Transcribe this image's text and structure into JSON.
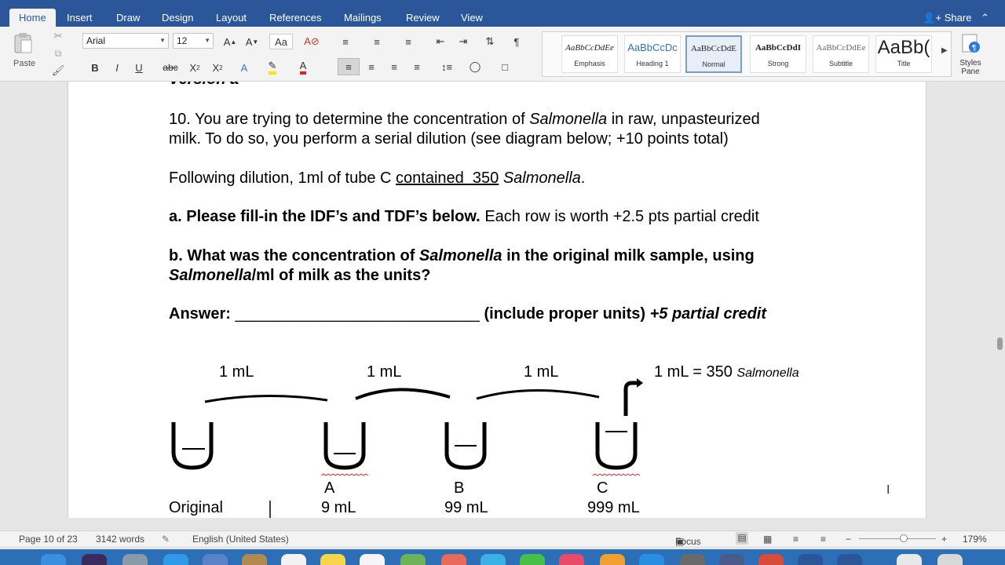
{
  "tabs": [
    "Home",
    "Insert",
    "Draw",
    "Design",
    "Layout",
    "References",
    "Mailings",
    "Review",
    "View"
  ],
  "share_label": "Share",
  "ribbon": {
    "paste_label": "Paste",
    "font_name": "Arial",
    "font_size": "12",
    "styles": [
      {
        "preview": "AaBbCcDdEe",
        "name": "Emphasis"
      },
      {
        "preview": "AaBbCcDc",
        "name": "Heading 1"
      },
      {
        "preview": "AaBbCcDdE",
        "name": "Normal"
      },
      {
        "preview": "AaBbCcDdI",
        "name": "Strong"
      },
      {
        "preview": "AaBbCcDdEe",
        "name": "Subtitle"
      },
      {
        "preview": "AaBb(",
        "name": "Title"
      }
    ],
    "styles_pane_label": "Styles Pane"
  },
  "doc": {
    "version_label": "Version a",
    "q10_num": "10.",
    "q10_a": "You are trying to determine the concentration of",
    "q10_organism": "Salmonella",
    "q10_b": "in raw, unpasteurized",
    "q10_line2": "milk. To do so, you perform a serial dilution (see diagram below; +10 points total)",
    "following_a": "Following dilution, 1ml of tube C",
    "following_ul": "contained  350",
    "following_org": "Salmonella",
    "following_end": ".",
    "a_bold": "a. Please fill-in the IDF’s and TDF’s below.",
    "a_rest": "Each row is worth +2.5 pts partial credit",
    "b_1": "b. What was the concentration of",
    "b_org": "Salmonella",
    "b_2": "in the original milk sample, using",
    "b_org2": "Salmonella",
    "b_3": "/ml of milk as the units?",
    "answer_label": "Answer:",
    "answer_blank": "____________________________",
    "answer_units": "(include proper units)",
    "answer_credit": "+5 partial credit",
    "transfers": [
      "1 mL",
      "1 mL",
      "1 mL"
    ],
    "final_a": "1 mL = 350",
    "final_org": "Salmonella",
    "tube_labels": [
      "A",
      "B",
      "C"
    ],
    "original_label": "Original",
    "volumes": [
      "9 mL",
      "99 mL",
      "999 mL"
    ]
  },
  "status": {
    "page": "Page 10 of 23",
    "words": "3142 words",
    "language": "English (United States)",
    "focus": "Focus",
    "zoom": "179%"
  }
}
